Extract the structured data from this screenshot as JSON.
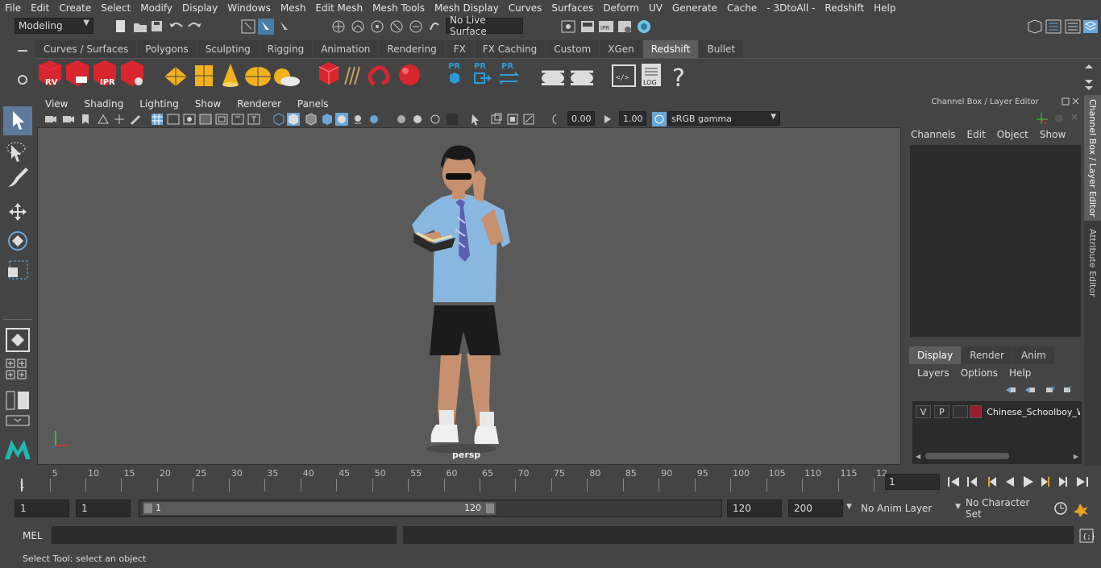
{
  "menubar": {
    "items": [
      "File",
      "Edit",
      "Create",
      "Select",
      "Modify",
      "Display",
      "Windows",
      "Mesh",
      "Edit Mesh",
      "Mesh Tools",
      "Mesh Display",
      "Curves",
      "Surfaces",
      "Deform",
      "UV",
      "Generate",
      "Cache",
      "- 3DtoAll -",
      "Redshift",
      "Help"
    ]
  },
  "statusline": {
    "mode": "Modeling",
    "live_surface": "No Live Surface"
  },
  "shelf": {
    "tabs": [
      "Curves / Surfaces",
      "Polygons",
      "Sculpting",
      "Rigging",
      "Animation",
      "Rendering",
      "FX",
      "FX Caching",
      "Custom",
      "XGen",
      "Redshift",
      "Bullet"
    ],
    "active_tab": "Redshift",
    "icon_labels": {
      "rv": "RV",
      "ipr": "IPR",
      "pr1": "PR",
      "pr2": "PR",
      "pr3": "PR",
      "log": "LOG",
      "help": "?"
    }
  },
  "viewport": {
    "menu": [
      "View",
      "Shading",
      "Lighting",
      "Show",
      "Renderer",
      "Panels"
    ],
    "exposure": "0.00",
    "gamma": "1.00",
    "color_space": "sRGB gamma",
    "camera_label": "persp"
  },
  "right_panel": {
    "title": "Channel Box / Layer Editor",
    "menu": [
      "Channels",
      "Edit",
      "Object",
      "Show"
    ],
    "layer_tabs": [
      "Display",
      "Render",
      "Anim"
    ],
    "active_layer_tab": "Display",
    "layer_menu": [
      "Layers",
      "Options",
      "Help"
    ],
    "layer": {
      "v": "V",
      "p": "P",
      "name": "Chinese_Schoolboy_W",
      "color": "#9b1b30"
    }
  },
  "side_tabs": [
    "Channel Box / Layer Editor",
    "Attribute Editor"
  ],
  "timeline": {
    "ticks": [
      5,
      10,
      15,
      20,
      25,
      30,
      35,
      40,
      45,
      50,
      55,
      60,
      65,
      70,
      75,
      80,
      85,
      90,
      95,
      100,
      105,
      110,
      115,
      12
    ],
    "start_label": "1",
    "current_frame": "1"
  },
  "range": {
    "start": "1",
    "playback_start": "1",
    "slider_start": "1",
    "slider_end": "120",
    "playback_end": "120",
    "end": "200",
    "anim_layer": "No Anim Layer",
    "character_set": "No Character Set"
  },
  "command": {
    "label": "MEL"
  },
  "help_line": {
    "text": "Select Tool: select an object"
  }
}
